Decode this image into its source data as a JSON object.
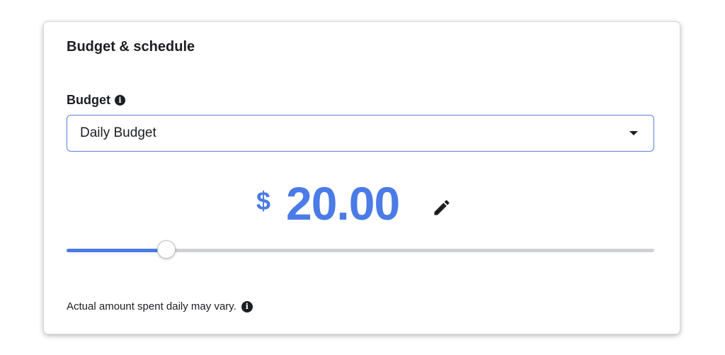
{
  "section": {
    "title": "Budget & schedule"
  },
  "budget": {
    "label": "Budget",
    "label_info_icon": "info-icon",
    "select": {
      "value": "Daily Budget",
      "caret_icon": "caret-down-icon"
    },
    "amount": {
      "currency": "$",
      "value": "20.00",
      "edit_icon": "pencil-icon"
    },
    "slider": {
      "level": 0.17
    }
  },
  "note": {
    "text": "Actual amount spent daily may vary.",
    "info_icon": "info-icon"
  },
  "colors": {
    "accent": "#4a7be6",
    "select_border": "#5b7fd6",
    "text": "#1c1e21",
    "track": "#cfd0d4"
  }
}
